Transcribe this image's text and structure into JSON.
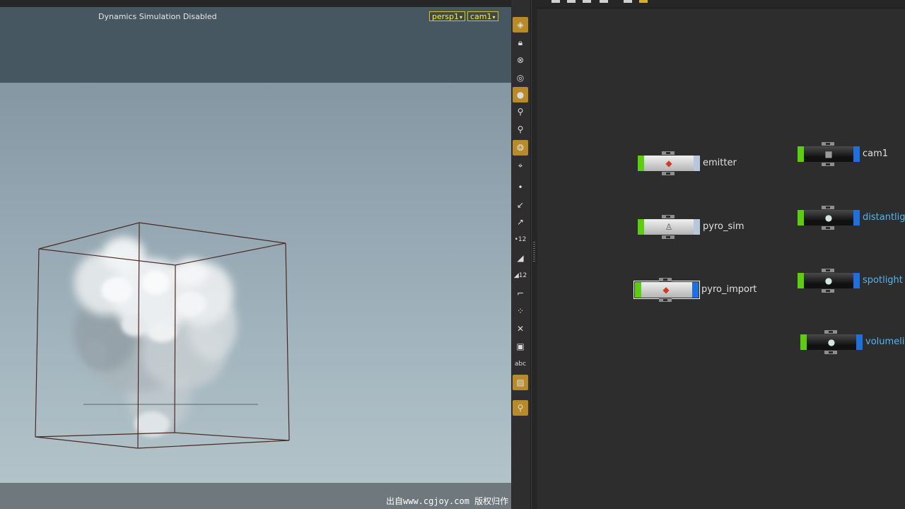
{
  "viewport": {
    "status": "Dynamics Simulation Disabled",
    "camera_menu": "persp1",
    "view_menu": "cam1",
    "background_top": "#475762",
    "background_gradient": [
      "#7b8d98",
      "#b6c6cc"
    ],
    "bbox_color": "#4a2a22"
  },
  "toolbar": {
    "items": [
      {
        "icon": "display-options-icon",
        "active": true
      },
      {
        "icon": "lock-icon",
        "active": false
      },
      {
        "icon": "snap-icon",
        "active": false
      },
      {
        "icon": "sphere-shading-icon",
        "active": false
      },
      {
        "icon": "headlight-icon",
        "active": true
      },
      {
        "icon": "light-icon",
        "active": false
      },
      {
        "icon": "light-ground-icon",
        "active": false
      },
      {
        "icon": "ghost-icon",
        "active": true
      },
      {
        "icon": "camera-icon",
        "active": false
      },
      {
        "icon": "point-icon",
        "active": false
      },
      {
        "icon": "normal-icon",
        "active": false
      },
      {
        "icon": "vector-icon",
        "active": false
      },
      {
        "icon": "point-number-icon",
        "active": false
      },
      {
        "icon": "prim-icon",
        "active": false
      },
      {
        "icon": "prim-number-icon",
        "active": false
      },
      {
        "icon": "uv-icon",
        "active": false
      },
      {
        "icon": "vertex-icon",
        "active": false
      },
      {
        "icon": "pivot-icon",
        "active": false
      },
      {
        "icon": "square-icon",
        "active": false
      },
      {
        "icon": "text-icon",
        "active": false
      },
      {
        "icon": "image-icon",
        "active": true
      },
      {
        "icon": "pin-icon",
        "active": true
      }
    ],
    "text_label": "abc"
  },
  "network": {
    "nodes": [
      {
        "id": "emitter",
        "label": "emitter",
        "style": "light",
        "right_flag": "pale",
        "icon": "shelf-tool-icon",
        "label_color": "white"
      },
      {
        "id": "pyro_sim",
        "label": "pyro_sim",
        "style": "light",
        "right_flag": "pale",
        "icon": "dop-icon",
        "label_color": "white"
      },
      {
        "id": "pyro_import",
        "label": "pyro_import",
        "style": "light",
        "right_flag": "blue",
        "icon": "shelf-tool-icon",
        "label_color": "white",
        "selected": true
      },
      {
        "id": "cam1",
        "label": "cam1",
        "style": "dark",
        "right_flag": "blue",
        "icon": "camera-icon",
        "label_color": "white"
      },
      {
        "id": "distantlight",
        "label": "distantlig",
        "style": "dark",
        "right_flag": "blue",
        "icon": "light-bulb-icon",
        "label_color": "blue"
      },
      {
        "id": "spotlight",
        "label": "spotlight",
        "style": "dark",
        "right_flag": "blue",
        "icon": "light-bulb-icon",
        "label_color": "blue"
      },
      {
        "id": "volumelight",
        "label": "volumeli",
        "style": "dark",
        "right_flag": "blue",
        "icon": "light-bulb-icon",
        "label_color": "blue"
      }
    ],
    "display_flag_color": "#5ccd10",
    "render_flag_color": "#1f6fdc"
  },
  "watermark": "出自www.cgjoy.com 版权归作者"
}
